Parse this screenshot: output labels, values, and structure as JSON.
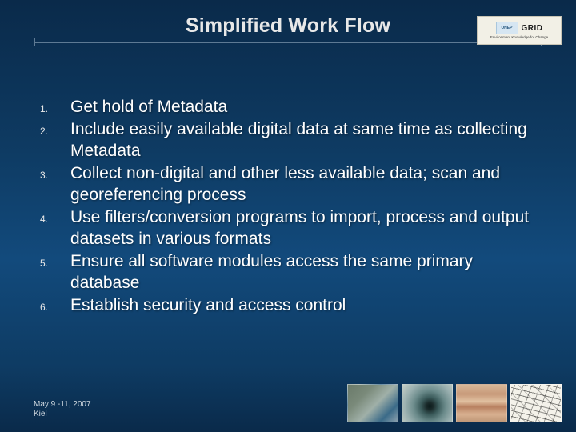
{
  "title": "Simplified Work Flow",
  "logo": {
    "unep": "UNEP",
    "grid": "GRID",
    "tagline": "Environment Knowledge for Change"
  },
  "items": [
    {
      "n": "1.",
      "text": "Get hold of Metadata"
    },
    {
      "n": "2.",
      "text": "Include easily available digital data at same time as collecting Metadata"
    },
    {
      "n": "3.",
      "text": "Collect non-digital and other less available data; scan and georeferencing process"
    },
    {
      "n": "4.",
      "text": "Use filters/conversion programs to import, process and output datasets in various formats"
    },
    {
      "n": "5.",
      "text": "Ensure all software modules access the same primary database"
    },
    {
      "n": "6.",
      "text": "Establish security and access control"
    }
  ],
  "footer": {
    "date": "May 9 -11, 2007",
    "place": "Kiel"
  }
}
